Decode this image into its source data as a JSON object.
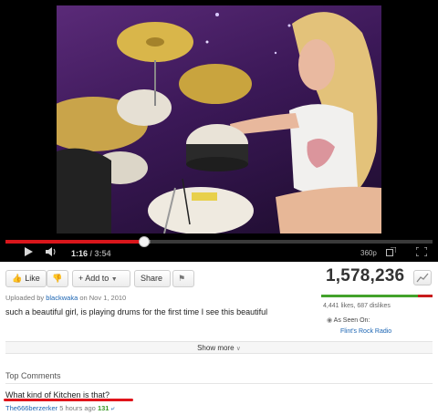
{
  "player": {
    "current_time": "1:16",
    "duration": "3:54",
    "played_fraction": 0.325,
    "loaded_fraction": 0.34,
    "quality": "360p",
    "icons": [
      "play-icon",
      "volume-icon",
      "popout-icon",
      "fullscreen-icon"
    ]
  },
  "actions": {
    "like_label": "Like",
    "add_to_label": "+ Add to",
    "share_label": "Share"
  },
  "stats": {
    "views": "1,578,236",
    "likes_dislikes": "4,441 likes, 687 dislikes",
    "like_fraction": 0.866
  },
  "upload": {
    "prefix": "Uploaded by",
    "user": "blackwaka",
    "date": "on Nov 1, 2010"
  },
  "description": "such a beautiful girl, is playing drums for the first time I see this beautiful",
  "seen_on": {
    "label": "As Seen On:",
    "link": "Flint's Rock Radio"
  },
  "show_more": "Show more",
  "comments": {
    "heading": "Top Comments",
    "items": [
      {
        "text": "What kind of Kitchen is that?",
        "user": "The666berzerker",
        "time": "5 hours ago",
        "score": "131"
      }
    ]
  },
  "colors": {
    "progress_played": "#d9161b",
    "like_bar_good": "#43a22b",
    "like_bar_bad": "#c81b1b",
    "link": "#1a64b3",
    "highlight_underline": "#e0141b"
  }
}
